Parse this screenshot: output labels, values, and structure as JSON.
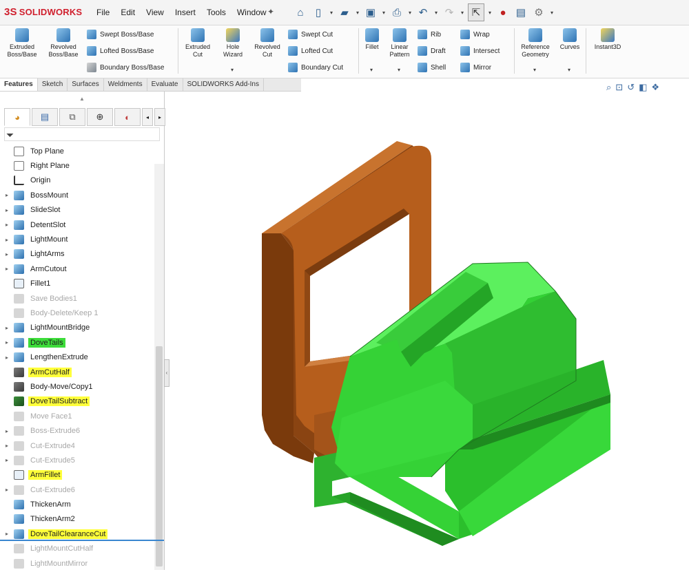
{
  "app": {
    "brand": "SOLIDWORKS",
    "brand_mark": "3S",
    "brand_color": "#d0202e"
  },
  "menu": [
    "File",
    "Edit",
    "View",
    "Insert",
    "Tools",
    "Window"
  ],
  "quick_access_icons": [
    "home-icon",
    "new-document-icon",
    "open-icon",
    "save-icon",
    "print-icon",
    "undo-icon",
    "redo-icon",
    "select-icon",
    "rebuild-icon",
    "file-properties-icon",
    "options-icon"
  ],
  "ribbon": {
    "extruded_boss": "Extruded\nBoss/Base",
    "revolved_boss": "Revolved\nBoss/Base",
    "swept_boss": "Swept Boss/Base",
    "lofted_boss": "Lofted Boss/Base",
    "boundary_boss": "Boundary Boss/Base",
    "extruded_cut": "Extruded\nCut",
    "hole_wizard": "Hole\nWizard",
    "revolved_cut": "Revolved\nCut",
    "swept_cut": "Swept Cut",
    "lofted_cut": "Lofted Cut",
    "boundary_cut": "Boundary Cut",
    "fillet": "Fillet",
    "linear_pattern": "Linear\nPattern",
    "rib": "Rib",
    "draft": "Draft",
    "shell": "Shell",
    "wrap": "Wrap",
    "intersect": "Intersect",
    "mirror": "Mirror",
    "reference_geometry": "Reference\nGeometry",
    "curves": "Curves",
    "instant3d": "Instant3D"
  },
  "tabs": [
    "Features",
    "Sketch",
    "Surfaces",
    "Weldments",
    "Evaluate",
    "SOLIDWORKS Add-Ins"
  ],
  "active_tab": "Features",
  "tree": [
    {
      "label": "Top Plane",
      "icon": "plane-icon",
      "state": "normal",
      "highlight": "none",
      "expandable": false
    },
    {
      "label": "Right Plane",
      "icon": "plane-icon",
      "state": "normal",
      "highlight": "none",
      "expandable": false
    },
    {
      "label": "Origin",
      "icon": "origin-icon",
      "state": "normal",
      "highlight": "none",
      "expandable": false
    },
    {
      "label": "BossMount",
      "icon": "extrude-feature-icon",
      "state": "normal",
      "highlight": "none",
      "expandable": true
    },
    {
      "label": "SlideSlot",
      "icon": "cut-feature-icon",
      "state": "normal",
      "highlight": "none",
      "expandable": true
    },
    {
      "label": "DetentSlot",
      "icon": "cut-feature-icon",
      "state": "normal",
      "highlight": "none",
      "expandable": true
    },
    {
      "label": "LightMount",
      "icon": "extrude-feature-icon",
      "state": "normal",
      "highlight": "none",
      "expandable": true
    },
    {
      "label": "LightArms",
      "icon": "extrude-feature-icon",
      "state": "normal",
      "highlight": "none",
      "expandable": true
    },
    {
      "label": "ArmCutout",
      "icon": "cut-feature-icon",
      "state": "normal",
      "highlight": "none",
      "expandable": true
    },
    {
      "label": "Fillet1",
      "icon": "fillet-icon",
      "state": "normal",
      "highlight": "none",
      "expandable": false
    },
    {
      "label": "Save Bodies1",
      "icon": "save-bodies-icon",
      "state": "suppressed",
      "highlight": "none",
      "expandable": false
    },
    {
      "label": "Body-Delete/Keep 1",
      "icon": "body-delete-icon",
      "state": "suppressed",
      "highlight": "none",
      "expandable": false
    },
    {
      "label": "LightMountBridge",
      "icon": "extrude-feature-icon",
      "state": "normal",
      "highlight": "none",
      "expandable": true
    },
    {
      "label": "DoveTails",
      "icon": "extrude-feature-icon",
      "state": "normal",
      "highlight": "green",
      "expandable": true
    },
    {
      "label": "LengthenExtrude",
      "icon": "extrude-feature-icon",
      "state": "normal",
      "highlight": "none",
      "expandable": true
    },
    {
      "label": "ArmCutHalf",
      "icon": "cut-feature-icon",
      "state": "normal",
      "highlight": "yellow",
      "expandable": false
    },
    {
      "label": "Body-Move/Copy1",
      "icon": "body-move-icon",
      "state": "normal",
      "highlight": "none",
      "expandable": false
    },
    {
      "label": "DoveTailSubtract",
      "icon": "combine-icon",
      "state": "normal",
      "highlight": "yellow",
      "expandable": false
    },
    {
      "label": "Move Face1",
      "icon": "move-face-icon",
      "state": "suppressed",
      "highlight": "none",
      "expandable": false
    },
    {
      "label": "Boss-Extrude6",
      "icon": "extrude-feature-icon",
      "state": "suppressed",
      "highlight": "none",
      "expandable": true
    },
    {
      "label": "Cut-Extrude4",
      "icon": "cut-feature-icon",
      "state": "suppressed",
      "highlight": "none",
      "expandable": true
    },
    {
      "label": "Cut-Extrude5",
      "icon": "cut-feature-icon",
      "state": "suppressed",
      "highlight": "none",
      "expandable": true
    },
    {
      "label": "ArmFillet",
      "icon": "fillet-icon",
      "state": "normal",
      "highlight": "yellow",
      "expandable": false
    },
    {
      "label": "Cut-Extrude6",
      "icon": "cut-feature-icon",
      "state": "suppressed",
      "highlight": "none",
      "expandable": true
    },
    {
      "label": "ThickenArm",
      "icon": "thicken-icon",
      "state": "normal",
      "highlight": "none",
      "expandable": false
    },
    {
      "label": "ThickenArm2",
      "icon": "thicken-icon",
      "state": "normal",
      "highlight": "none",
      "expandable": false
    },
    {
      "label": "DoveTailClearanceCut",
      "icon": "cut-feature-icon",
      "state": "normal",
      "highlight": "yellow",
      "expandable": true
    },
    {
      "label": "LightMountCutHalf",
      "icon": "cut-feature-icon",
      "state": "suppressed",
      "highlight": "none",
      "expandable": false
    },
    {
      "label": "LightMountMirror",
      "icon": "mirror-icon",
      "state": "suppressed",
      "highlight": "none",
      "expandable": false
    }
  ],
  "colors": {
    "bracket": "#b65e1c",
    "dovetail": "#35d236",
    "highlight_yellow": "#ffff3a",
    "highlight_green": "#3ddc3a",
    "rollback_bar": "#3a86d0"
  }
}
